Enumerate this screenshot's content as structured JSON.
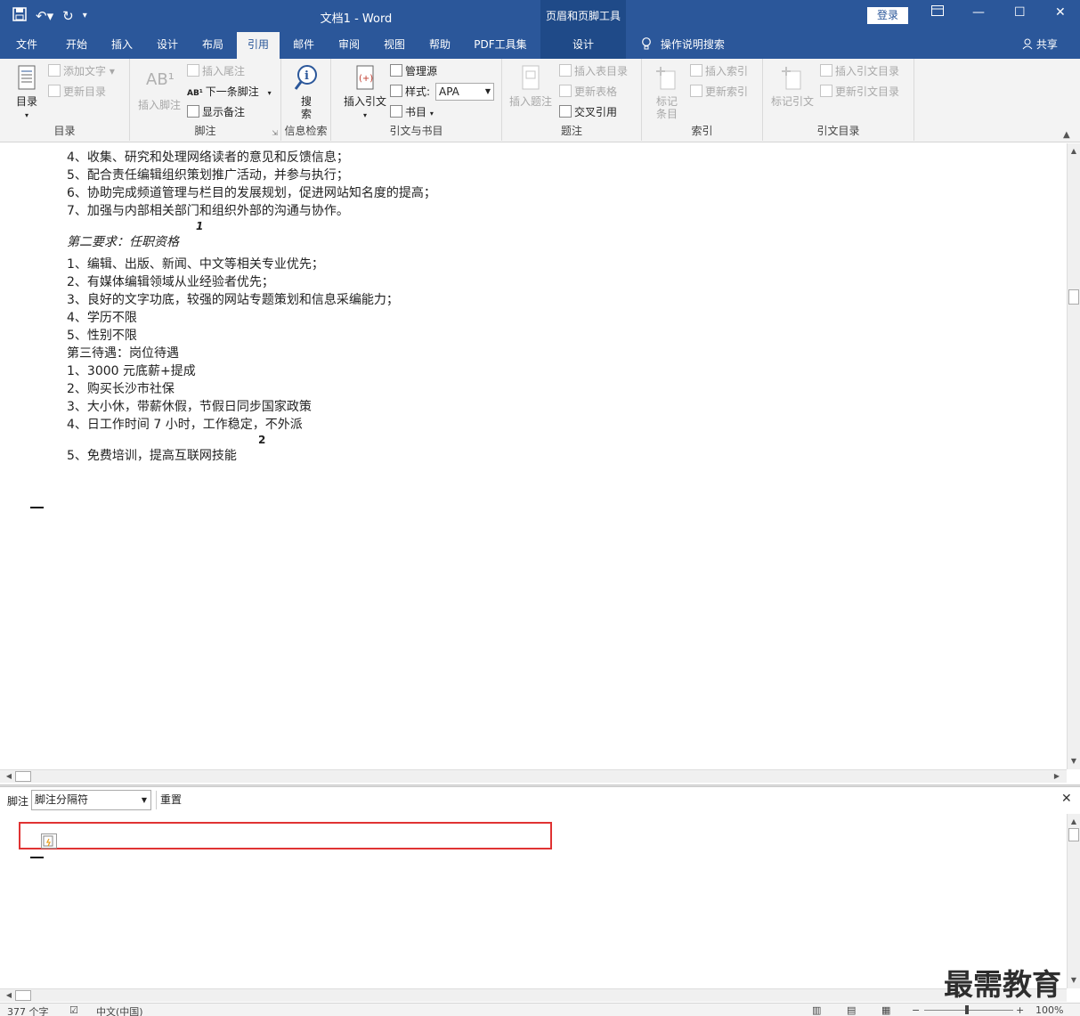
{
  "titlebar": {
    "doc_title": "文档1  -  Word",
    "context_group": "页眉和页脚工具",
    "login": "登录",
    "icons": [
      "save-icon",
      "undo-icon",
      "redo-icon",
      "customize-qat-icon",
      "ribbon-display-icon",
      "minimize-icon",
      "maximize-icon",
      "close-icon"
    ]
  },
  "tabs": [
    "文件",
    "开始",
    "插入",
    "设计",
    "布局",
    "引用",
    "邮件",
    "审阅",
    "视图",
    "帮助",
    "PDF工具集"
  ],
  "active_tab": "引用",
  "context_tab": "设计",
  "tell_me": "操作说明搜索",
  "share": "共享",
  "ribbon": {
    "toc": {
      "big": "目录",
      "add_text": "添加文字",
      "update_toc": "更新目录",
      "label": "目录"
    },
    "footnotes": {
      "insert_footnote": "插入脚注",
      "insert_endnote": "插入尾注",
      "next_footnote": "下一条脚注",
      "show_notes": "显示备注",
      "label": "脚注"
    },
    "research": {
      "search": "搜\n索",
      "label": "信息检索"
    },
    "citations": {
      "insert_citation": "插入引文",
      "manage_sources": "管理源",
      "style_label": "样式:",
      "style_value": "APA",
      "bibliography": "书目",
      "label": "引文与书目"
    },
    "captions": {
      "insert_caption": "插入题注",
      "insert_table_of_figures": "插入表目录",
      "update_table": "更新表格",
      "cross_reference": "交叉引用",
      "label": "题注"
    },
    "index": {
      "mark_entry": "标记\n条目",
      "insert_index": "插入索引",
      "update_index": "更新索引",
      "label": "索引"
    },
    "authorities": {
      "mark_citation": "标记引文",
      "insert_toa": "插入引文目录",
      "update_toa": "更新引文目录",
      "label": "引文目录"
    }
  },
  "document": {
    "lines": [
      "4、收集、研究和处理网络读者的意见和反馈信息；",
      "5、配合责任编辑组织策划推广活动，并参与执行；",
      "6、协助完成频道管理与栏目的发展规划，促进网站知名度的提高；",
      "7、加强与内部相关部门和组织外部的沟通与协作。",
      "第二要求：任职资格",
      "1、编辑、出版、新闻、中文等相关专业优先；",
      "2、有媒体编辑领域从业经验者优先；",
      "3、良好的文字功底，较强的网站专题策划和信息采编能力；",
      "4、学历不限",
      "5、性别不限",
      "第三待遇：岗位待遇",
      "1、3000 元底薪+提成",
      "2、购买长沙市社保",
      "3、大小休，带薪休假，节假日同步国家政策",
      "4、日工作时间 7 小时，工作稳定，不外派",
      "5、免费培训，提高互联网技能"
    ],
    "footnote_ref_1": "1",
    "footnote_ref_2": "2"
  },
  "footnote_pane": {
    "label": "脚注",
    "selected": "脚注分隔符",
    "reset": "重置"
  },
  "statusbar": {
    "word_count": "377 个字",
    "language": "中文(中国)",
    "zoom": "100%"
  },
  "watermark": "最需教育"
}
